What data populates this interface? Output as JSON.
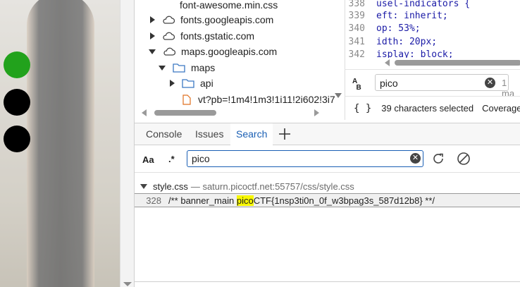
{
  "file_tree": {
    "rows": [
      {
        "label": "font-awesome.min.css",
        "kind": "file"
      },
      {
        "label": "fonts.googleapis.com",
        "kind": "domain",
        "state": "collapsed"
      },
      {
        "label": "fonts.gstatic.com",
        "kind": "domain",
        "state": "collapsed"
      },
      {
        "label": "maps.googleapis.com",
        "kind": "domain",
        "state": "expanded"
      },
      {
        "label": "maps",
        "kind": "folder",
        "state": "expanded"
      },
      {
        "label": "api",
        "kind": "folder",
        "state": "collapsed"
      },
      {
        "label": "vt?pb=!1m4!1m3!1i11!2i602!3i7",
        "kind": "file"
      }
    ]
  },
  "code_pane": {
    "lines": [
      {
        "num": "338",
        "text": "usel-indicators {"
      },
      {
        "num": "339",
        "text": "eft: inherit;"
      },
      {
        "num": "340",
        "text": "op: 53%;"
      },
      {
        "num": "341",
        "text": "idth: 20px;"
      },
      {
        "num": "342",
        "text": "isplay: block;"
      }
    ]
  },
  "editor_find": {
    "value": "pico",
    "count": "1 ma"
  },
  "editor_status": {
    "braces": "{ }",
    "selection": "39 characters selected",
    "coverage": "Coverage:"
  },
  "drawer": {
    "tabs": [
      {
        "label": "Console",
        "active": false
      },
      {
        "label": "Issues",
        "active": false
      },
      {
        "label": "Search",
        "active": true
      }
    ]
  },
  "search": {
    "aa_label": "Aa",
    "regex_label": ".*",
    "value": "pico",
    "result_file": {
      "name": "style.css",
      "path": "— saturn.picoctf.net:55757/css/style.css"
    },
    "result_line": {
      "num": "328",
      "before": "/** banner_main ",
      "match": "pico",
      "after": "CTF{1nsp3ti0n_0f_w3bpag3s_587d12b8} **/"
    }
  },
  "colors": {
    "accent": "#1a5fb4",
    "highlight": "#f7f700",
    "dot_green": "#22a21c"
  }
}
